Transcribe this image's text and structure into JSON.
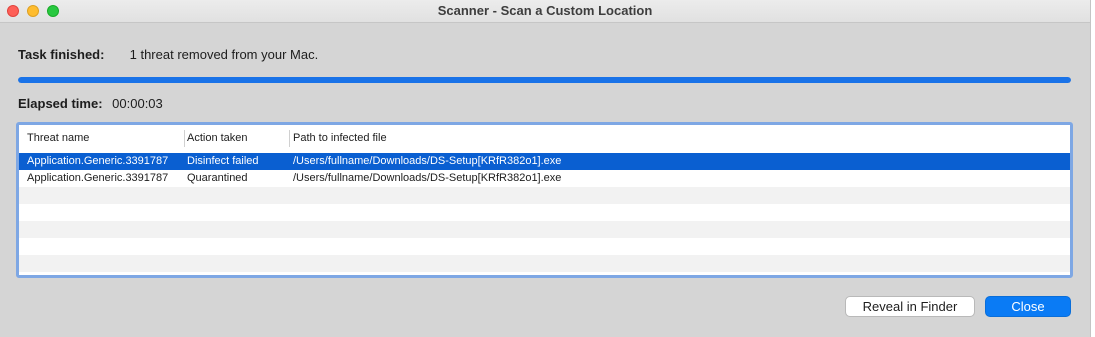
{
  "window": {
    "title": "Scanner - Scan a Custom Location"
  },
  "status": {
    "label": "Task finished:",
    "message": "1 threat removed from your Mac."
  },
  "progress": {
    "percent": 100,
    "color": "#1a73e8"
  },
  "elapsed": {
    "label": "Elapsed time:",
    "value": "00:00:03"
  },
  "table": {
    "columns": [
      "Threat name",
      "Action taken",
      "Path to infected file"
    ],
    "rows": [
      {
        "threat": "Application.Generic.3391787",
        "action": "Disinfect failed",
        "path": "/Users/fullname/Downloads/DS-Setup[KRfR382o1].exe",
        "selected": true
      },
      {
        "threat": "Application.Generic.3391787",
        "action": "Quarantined",
        "path": "/Users/fullname/Downloads/DS-Setup[KRfR382o1].exe",
        "selected": false
      }
    ]
  },
  "buttons": {
    "reveal": "Reveal in Finder",
    "close": "Close"
  },
  "colors": {
    "accent": "#0a7bf5",
    "selection": "#0a5fd1",
    "background": "#d5d5d5"
  }
}
